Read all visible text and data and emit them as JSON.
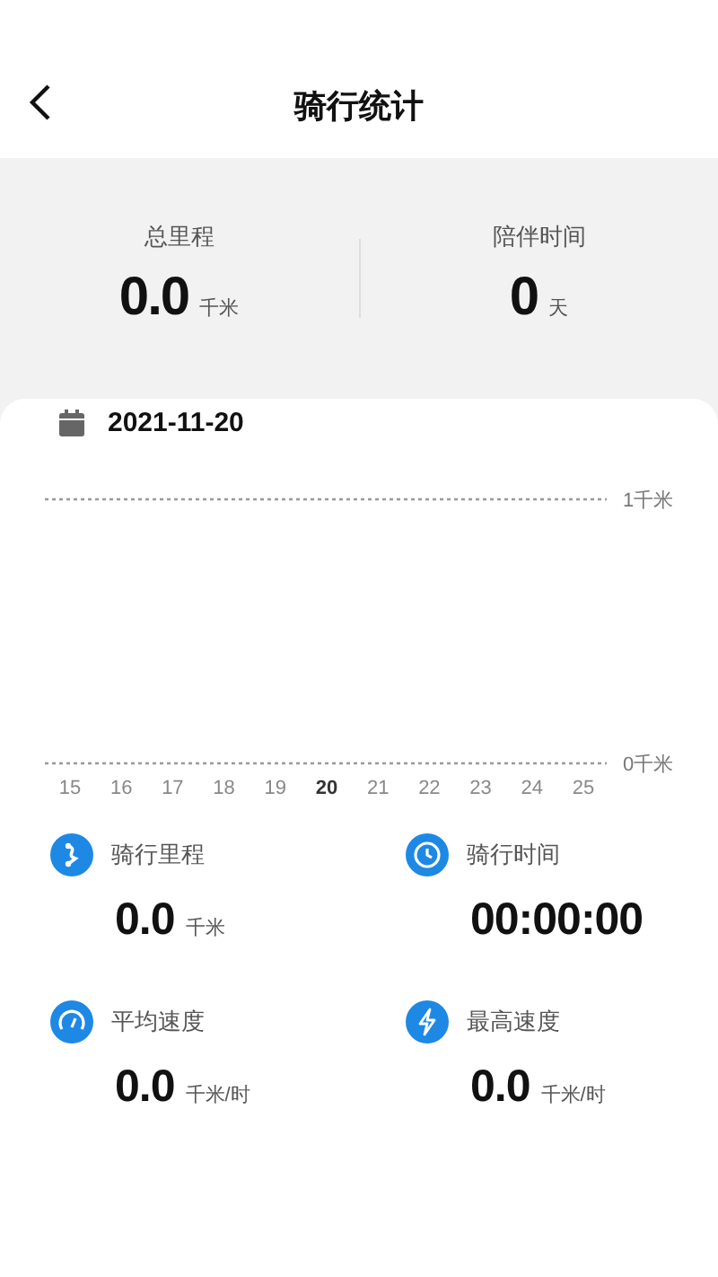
{
  "header": {
    "title": "骑行统计"
  },
  "summary": [
    {
      "label": "总里程",
      "value": "0.0",
      "unit": "千米"
    },
    {
      "label": "陪伴时间",
      "value": "0",
      "unit": "天"
    }
  ],
  "date": "2021-11-20",
  "chart_data": {
    "type": "bar",
    "categories": [
      "15",
      "16",
      "17",
      "18",
      "19",
      "20",
      "21",
      "22",
      "23",
      "24",
      "25"
    ],
    "values": [
      0,
      0,
      0,
      0,
      0,
      0,
      0,
      0,
      0,
      0,
      0
    ],
    "ylim": [
      0,
      1
    ],
    "yticks": [
      {
        "value": 0,
        "label": "0千米"
      },
      {
        "value": 1,
        "label": "1千米"
      }
    ],
    "annotations": [
      {
        "x": "20"
      }
    ]
  },
  "stats": [
    {
      "kind": "distance",
      "label": "骑行里程",
      "value": "0.0",
      "unit": "千米"
    },
    {
      "kind": "time",
      "label": "骑行时间",
      "value": "00:00:00"
    },
    {
      "kind": "avg_speed",
      "label": "平均速度",
      "value": "0.0",
      "unit": "千米/时"
    },
    {
      "kind": "max_speed",
      "label": "最高速度",
      "value": "0.0",
      "unit": "千米/时"
    }
  ]
}
